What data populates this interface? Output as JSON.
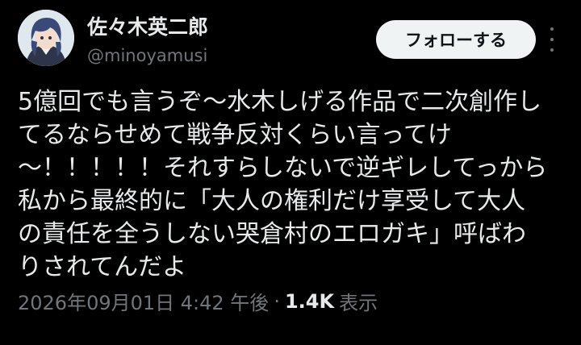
{
  "tweet": {
    "author": {
      "display_name": "佐々木英二郎",
      "handle": "@minoyamusi"
    },
    "follow_button_label": "フォローする",
    "more_icon": "more-vertical-icon",
    "text_lines": [
      "5億回でも言うぞ〜水木しげる作品で二次創作し",
      "てるならせめて戦争反対くらい言ってけ",
      "〜！！！！！それすらしないで逆ギレしてっから",
      "私から最終的に「大人の権利だけ享受して大人",
      "の責任を全うしない哭倉村のエロガキ」呼ばわ",
      "りされてんだよ"
    ],
    "meta": {
      "time": "2026年09月01日 4:42 午後",
      "separator": "·",
      "views_count": "1.4K",
      "views_label": "表示"
    }
  },
  "colors": {
    "background": "#000000",
    "text_primary": "#e7e9ea",
    "text_secondary": "#71767b",
    "follow_button_bg": "#eff3f4",
    "follow_button_text": "#0f1419"
  }
}
